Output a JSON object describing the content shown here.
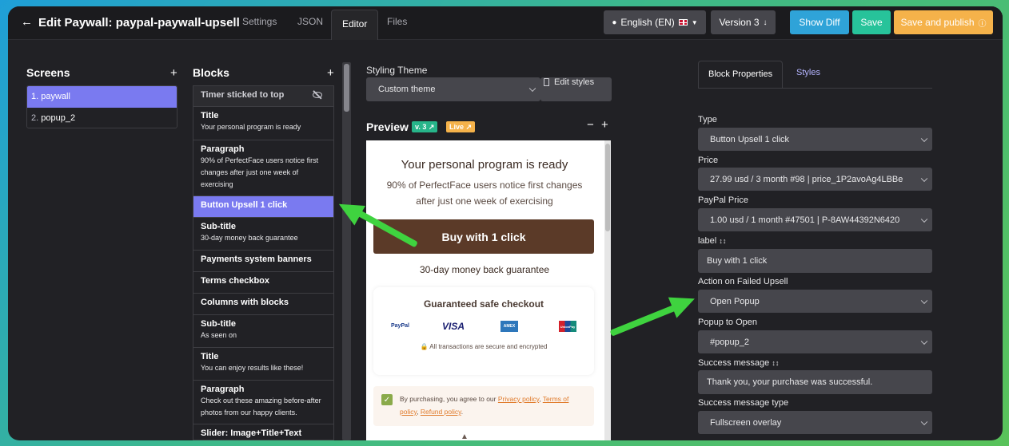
{
  "header": {
    "title": "Edit Paywall: paypal-paywall-upsell",
    "tabs": [
      "Settings",
      "JSON",
      "Editor",
      "Files"
    ],
    "active_tab": "Editor",
    "language": "English (EN)",
    "version": "Version 3",
    "show_diff": "Show Diff",
    "save": "Save",
    "save_publish": "Save and publish"
  },
  "screens": {
    "title": "Screens",
    "items": [
      {
        "num": "1.",
        "name": "paywall"
      },
      {
        "num": "2.",
        "name": "popup_2"
      }
    ]
  },
  "blocks": {
    "title": "Blocks",
    "items": [
      {
        "title": "Timer sticked to top",
        "sub": ""
      },
      {
        "title": "Title",
        "sub": "Your personal program is ready"
      },
      {
        "title": "Paragraph",
        "sub": "90% of PerfectFace users notice first changes after just one week of exercising"
      },
      {
        "title": "Button Upsell 1 click",
        "sub": ""
      },
      {
        "title": "Sub-title",
        "sub": "30-day money back guarantee"
      },
      {
        "title": "Payments system banners",
        "sub": ""
      },
      {
        "title": "Terms checkbox",
        "sub": ""
      },
      {
        "title": "Columns with blocks",
        "sub": ""
      },
      {
        "title": "Sub-title",
        "sub": "As seen on"
      },
      {
        "title": "Title",
        "sub": "You can enjoy results like these!"
      },
      {
        "title": "Paragraph",
        "sub": "Check out these amazing before-after photos from our happy clients."
      },
      {
        "title": "Slider: Image+Title+Text",
        "sub": ""
      }
    ]
  },
  "styling": {
    "label": "Styling Theme",
    "theme": "Custom theme",
    "edit_styles": "Edit styles"
  },
  "preview": {
    "label": "Preview",
    "version_badge": "v. 3",
    "live_badge": "Live",
    "heading": "Your personal program is ready",
    "paragraph": "90% of PerfectFace users notice first changes after just one week of exercising",
    "buy_button": "Buy with 1 click",
    "guarantee": "30-day money back guarantee",
    "checkout_title": "Guaranteed safe checkout",
    "payment_logos": [
      "PayPal",
      "VISA",
      "AMEX",
      "UnionPay"
    ],
    "secure_note": "All transactions are secure and encrypted",
    "terms_prefix": "By purchasing, you agree to our",
    "privacy": "Privacy policy",
    "terms": "Terms of policy",
    "refund": "Refund policy"
  },
  "properties": {
    "tabs": [
      "Block Properties",
      "Styles"
    ],
    "fields": {
      "type": {
        "label": "Type",
        "value": "Button Upsell 1 click"
      },
      "price": {
        "label": "Price",
        "value": "27.99 usd / 3 month #98 | price_1P2avoAg4LBBe"
      },
      "paypal_price": {
        "label": "PayPal Price",
        "value": "1.00 usd / 1 month #47501 | P-8AW44392N6420"
      },
      "label": {
        "label": "label",
        "value": "Buy with 1 click"
      },
      "action_failed": {
        "label": "Action on Failed Upsell",
        "value": "Open Popup"
      },
      "popup_to_open": {
        "label": "Popup to Open",
        "value": "#popup_2"
      },
      "success_message": {
        "label": "Success message",
        "value": "Thank you, your purchase was successful."
      },
      "success_type": {
        "label": "Success message type",
        "value": "Fullscreen overlay"
      }
    }
  },
  "colors": {
    "accent": "#7a7af0",
    "show_diff": "#2fa3d8",
    "save": "#27c39a",
    "save_publish": "#f5b24a",
    "annotation_arrow": "#3fd33f"
  }
}
